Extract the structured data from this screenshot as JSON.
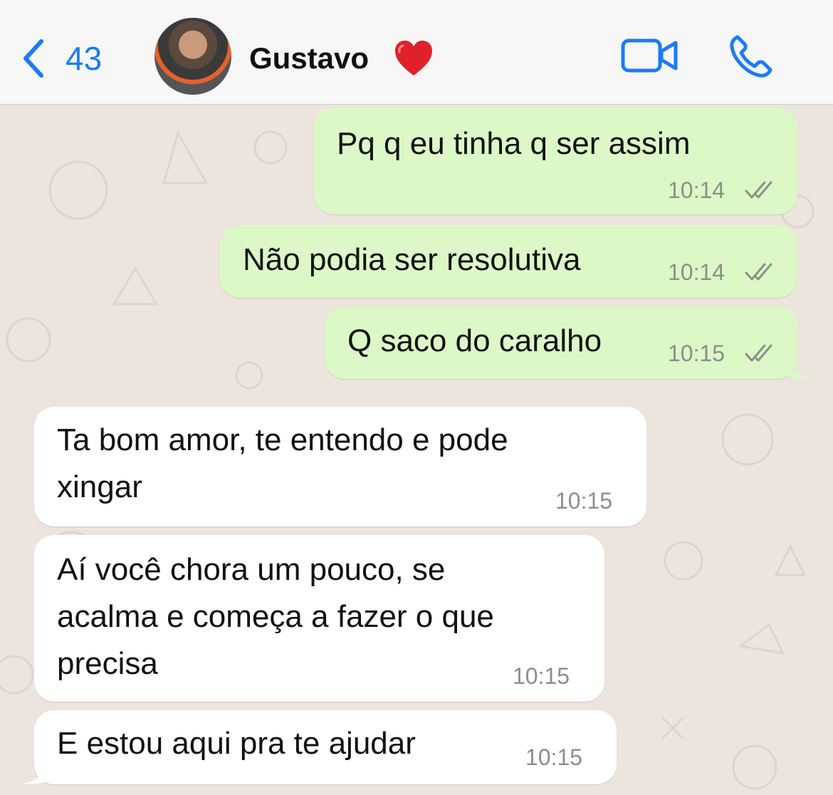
{
  "header": {
    "back_count": "43",
    "contact_name": "Gustavo",
    "heart_icon": "red-heart-emoji",
    "accent_color": "#1a7cf5"
  },
  "messages": [
    {
      "direction": "out",
      "lines": [
        "Pq q eu tinha q ser assim"
      ],
      "time": "10:14",
      "status": "read-ticks"
    },
    {
      "direction": "out",
      "lines": [
        "Não podia ser resolutiva"
      ],
      "time": "10:14",
      "status": "read-ticks"
    },
    {
      "direction": "out",
      "lines": [
        "Q saco do caralho"
      ],
      "time": "10:15",
      "status": "read-ticks"
    },
    {
      "direction": "in",
      "lines": [
        "Ta bom amor, te entendo e pode",
        "xingar"
      ],
      "time": "10:15"
    },
    {
      "direction": "in",
      "lines": [
        "Aí você chora um pouco, se",
        "acalma e começa a fazer o que",
        "precisa"
      ],
      "time": "10:15"
    },
    {
      "direction": "in",
      "lines": [
        "E estou aqui pra te ajudar"
      ],
      "time": "10:15"
    }
  ],
  "colors": {
    "outgoing_bubble": "#dcf8c6",
    "incoming_bubble": "#ffffff",
    "chat_background": "#ece5dd"
  }
}
